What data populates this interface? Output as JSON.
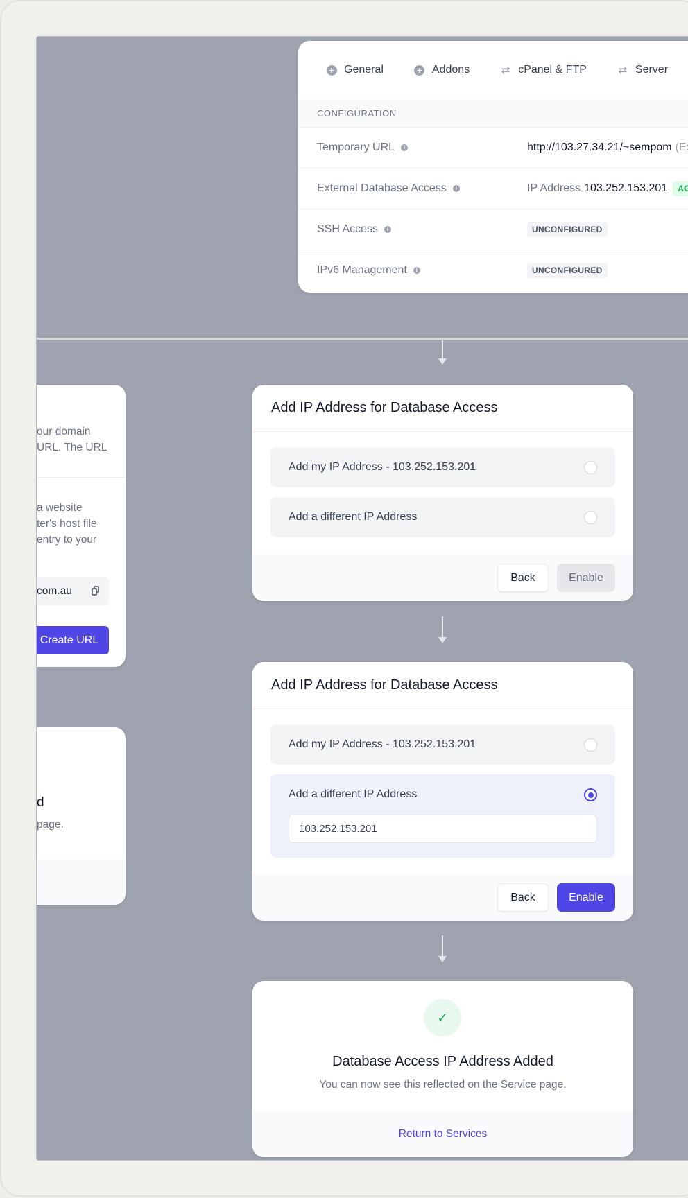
{
  "config": {
    "tabs": [
      {
        "label": "General",
        "icon": "plus-circle-icon"
      },
      {
        "label": "Addons",
        "icon": "plus-circle-icon"
      },
      {
        "label": "cPanel & FTP",
        "icon": "swap-arrows-icon"
      },
      {
        "label": "Server",
        "icon": "swap-arrows-icon"
      }
    ],
    "section_title": "CONFIGURATION",
    "rows": [
      {
        "label": "Temporary URL",
        "value": "http://103.27.34.21/~sempom",
        "value_suffix": "(Ex"
      },
      {
        "label": "External Database Access",
        "value_prefix": "IP Address",
        "value": "103.252.153.201",
        "badge": "ACT"
      },
      {
        "label": "SSH Access",
        "badge": "UNCONFIGURED"
      },
      {
        "label": "IPv6 Management",
        "badge": "UNCONFIGURED"
      }
    ]
  },
  "left_card_1": {
    "text_1": [
      "our domain",
      "URL. The URL"
    ],
    "text_2": [
      "a website",
      "ter's host file",
      "entry to your"
    ],
    "url_value": "com.au",
    "create_label": "Create URL"
  },
  "left_card_2": {
    "heading": "d",
    "text": "page."
  },
  "ip_card_1": {
    "title": "Add IP Address for Database Access",
    "option_1": "Add my IP Address - 103.252.153.201",
    "option_2": "Add a different IP Address",
    "back_label": "Back",
    "enable_label": "Enable"
  },
  "ip_card_2": {
    "title": "Add IP Address for Database Access",
    "option_1": "Add my IP Address - 103.252.153.201",
    "option_2": "Add a different IP Address",
    "input_value": "103.252.153.201",
    "back_label": "Back",
    "enable_label": "Enable"
  },
  "success": {
    "title": "Database Access IP Address Added",
    "subtitle": "You can now see this reflected on the Service page.",
    "link_label": "Return to Services"
  },
  "colors": {
    "accent": "#4f46e5",
    "canvas": "#9ea3af",
    "success": "#16a34a"
  }
}
